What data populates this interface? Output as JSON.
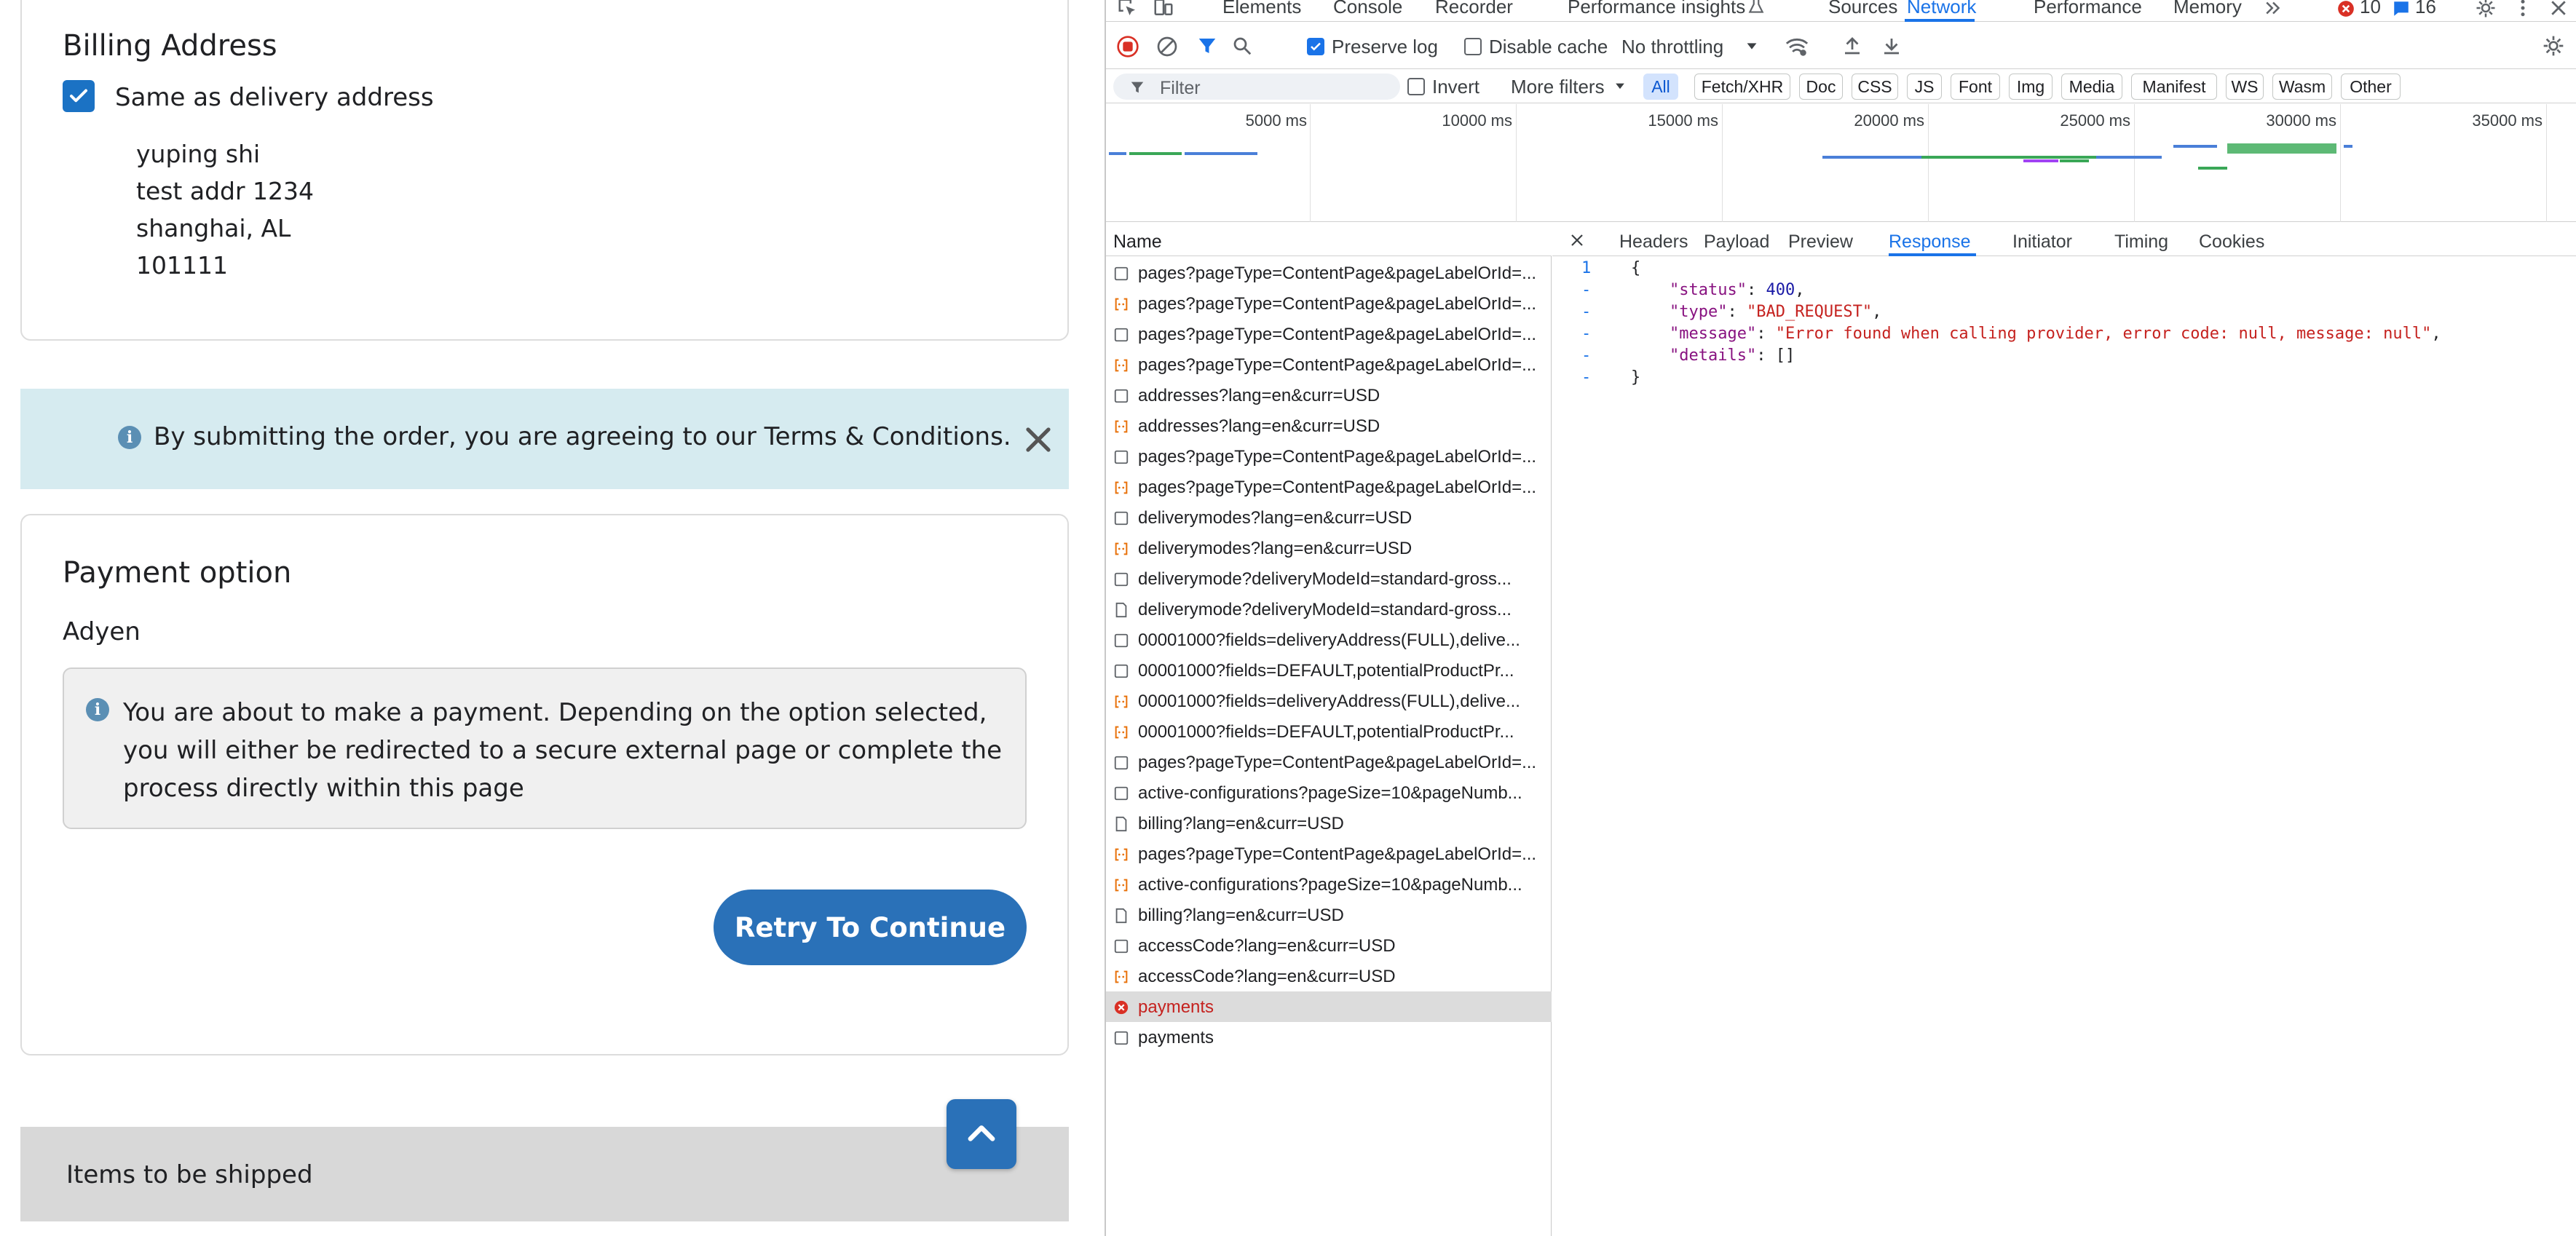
{
  "billing": {
    "title": "Billing Address",
    "same_as_label": "Same as delivery address",
    "address_lines": [
      "yuping shi",
      "test addr 1234",
      "shanghai, AL",
      "101111"
    ]
  },
  "terms": {
    "text": "By submitting the order, you are agreeing to our Terms & Conditions."
  },
  "payment": {
    "title": "Payment option",
    "method": "Adyen",
    "info_text": "You are about to make a payment. Depending on the option selected, you will either be redirected to a secure external page or complete the process directly within this page",
    "retry_label": "Retry To Continue"
  },
  "items": {
    "title": "Items to be shipped"
  },
  "devtools": {
    "tabs": [
      "Elements",
      "Console",
      "Recorder",
      "Performance insights",
      "Sources",
      "Network",
      "Performance",
      "Memory"
    ],
    "active_tab": "Network",
    "error_count": "10",
    "message_count": "16",
    "toolbar": {
      "preserve_log": "Preserve log",
      "disable_cache": "Disable cache",
      "throttling": "No throttling"
    },
    "filter": {
      "placeholder": "Filter",
      "invert": "Invert",
      "more_filters": "More filters",
      "chips": [
        "All",
        "Fetch/XHR",
        "Doc",
        "CSS",
        "JS",
        "Font",
        "Img",
        "Media",
        "Manifest",
        "WS",
        "Wasm",
        "Other"
      ],
      "active_chip": "All"
    },
    "timeline": {
      "labels": [
        "5000 ms",
        "10000 ms",
        "15000 ms",
        "20000 ms",
        "25000 ms",
        "30000 ms",
        "35000 ms"
      ]
    },
    "requests": {
      "header": "Name",
      "rows": [
        {
          "name": "pages?pageType=ContentPage&pageLabelOrId=...",
          "kind": "doc"
        },
        {
          "name": "pages?pageType=ContentPage&pageLabelOrId=...",
          "kind": "fetch"
        },
        {
          "name": "pages?pageType=ContentPage&pageLabelOrId=...",
          "kind": "doc"
        },
        {
          "name": "pages?pageType=ContentPage&pageLabelOrId=...",
          "kind": "fetch"
        },
        {
          "name": "addresses?lang=en&curr=USD",
          "kind": "doc"
        },
        {
          "name": "addresses?lang=en&curr=USD",
          "kind": "fetch"
        },
        {
          "name": "pages?pageType=ContentPage&pageLabelOrId=...",
          "kind": "doc"
        },
        {
          "name": "pages?pageType=ContentPage&pageLabelOrId=...",
          "kind": "fetch"
        },
        {
          "name": "deliverymodes?lang=en&curr=USD",
          "kind": "doc"
        },
        {
          "name": "deliverymodes?lang=en&curr=USD",
          "kind": "fetch"
        },
        {
          "name": "deliverymode?deliveryModeId=standard-gross...",
          "kind": "doc"
        },
        {
          "name": "deliverymode?deliveryModeId=standard-gross...",
          "kind": "file"
        },
        {
          "name": "00001000?fields=deliveryAddress(FULL),delive...",
          "kind": "doc"
        },
        {
          "name": "00001000?fields=DEFAULT,potentialProductPr...",
          "kind": "doc"
        },
        {
          "name": "00001000?fields=deliveryAddress(FULL),delive...",
          "kind": "fetch"
        },
        {
          "name": "00001000?fields=DEFAULT,potentialProductPr...",
          "kind": "fetch"
        },
        {
          "name": "pages?pageType=ContentPage&pageLabelOrId=...",
          "kind": "doc"
        },
        {
          "name": "active-configurations?pageSize=10&pageNumb...",
          "kind": "doc"
        },
        {
          "name": "billing?lang=en&curr=USD",
          "kind": "file"
        },
        {
          "name": "pages?pageType=ContentPage&pageLabelOrId=...",
          "kind": "fetch"
        },
        {
          "name": "active-configurations?pageSize=10&pageNumb...",
          "kind": "fetch"
        },
        {
          "name": "billing?lang=en&curr=USD",
          "kind": "file"
        },
        {
          "name": "accessCode?lang=en&curr=USD",
          "kind": "doc"
        },
        {
          "name": "accessCode?lang=en&curr=USD",
          "kind": "fetch"
        },
        {
          "name": "payments",
          "kind": "error"
        },
        {
          "name": "payments",
          "kind": "doc"
        }
      ]
    },
    "detail": {
      "tabs": [
        "Headers",
        "Payload",
        "Preview",
        "Response",
        "Initiator",
        "Timing",
        "Cookies"
      ],
      "active_tab": "Response",
      "response_lines": [
        {
          "ln": "1",
          "text": "{"
        },
        {
          "ln": "-",
          "text": "    \"status\": 400,"
        },
        {
          "ln": "-",
          "text": "    \"type\": \"BAD_REQUEST\","
        },
        {
          "ln": "-",
          "text": "    \"message\": \"Error found when calling provider, error code: null, message: null\","
        },
        {
          "ln": "-",
          "text": "    \"details\": []"
        },
        {
          "ln": "-",
          "text": "}"
        }
      ]
    }
  }
}
